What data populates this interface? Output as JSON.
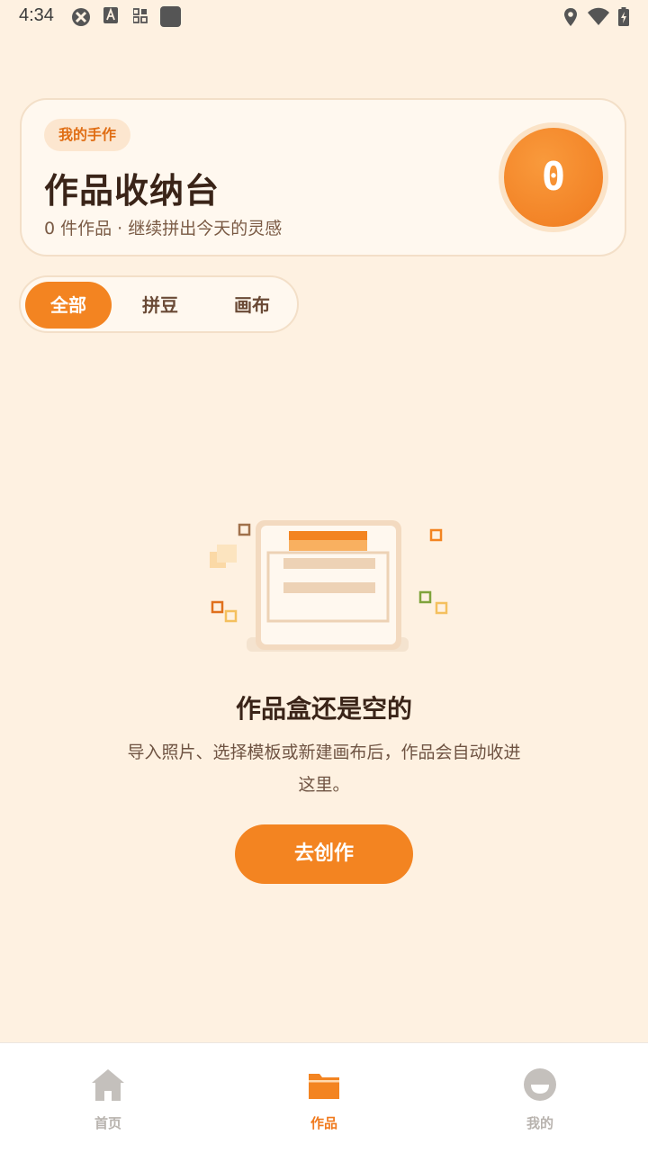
{
  "status_bar": {
    "time": "4:34"
  },
  "hero": {
    "badge": "我的手作",
    "title": "作品收纳台",
    "subtitle": "0 件作品 · 继续拼出今天的灵感",
    "count": "0"
  },
  "tabs": [
    {
      "label": "全部",
      "active": true
    },
    {
      "label": "拼豆",
      "active": false
    },
    {
      "label": "画布",
      "active": false
    }
  ],
  "empty_state": {
    "title": "作品盒还是空的",
    "description": "导入照片、选择模板或新建画布后，作品会自动收进这里。",
    "button_label": "去创作"
  },
  "bottom_nav": [
    {
      "label": "首页",
      "icon": "home-icon",
      "active": false
    },
    {
      "label": "作品",
      "icon": "folder-icon",
      "active": true
    },
    {
      "label": "我的",
      "icon": "profile-icon",
      "active": false
    }
  ],
  "colors": {
    "accent": "#F38421",
    "background": "#FEF1E1",
    "text": "#3A2418"
  }
}
